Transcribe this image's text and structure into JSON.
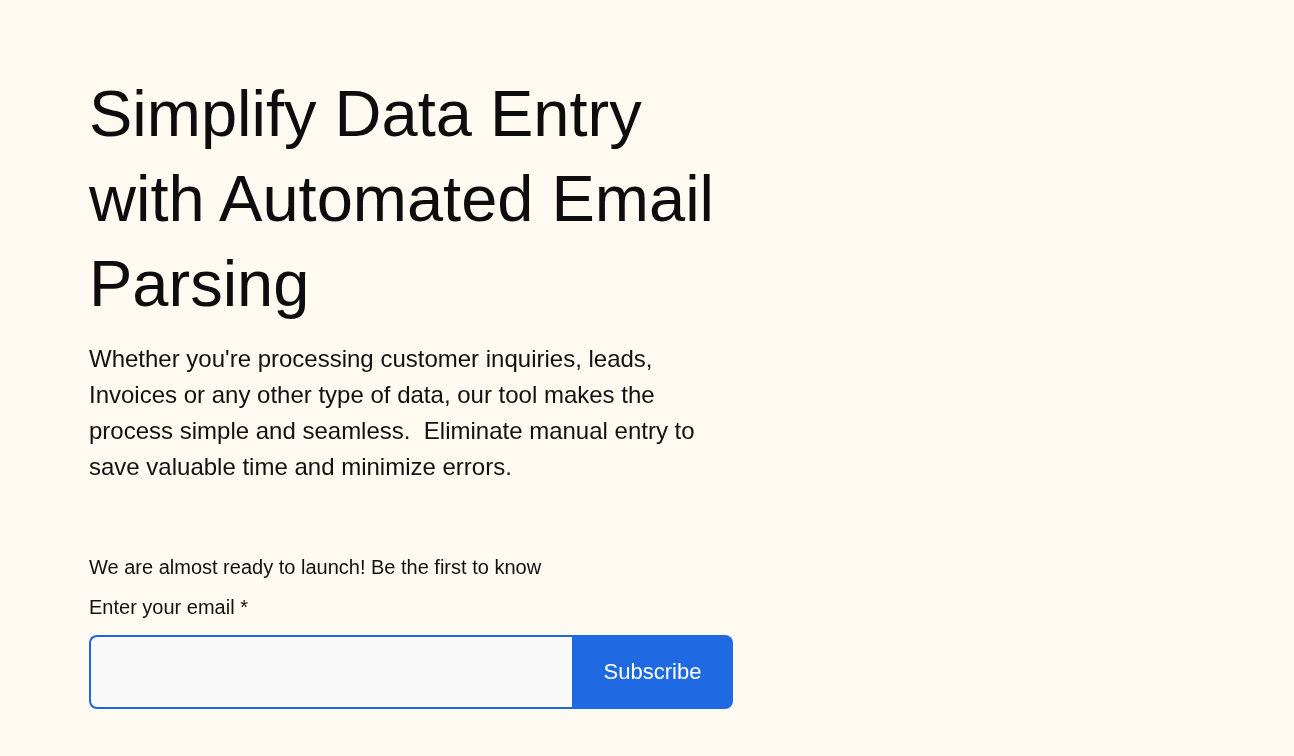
{
  "hero": {
    "title": "Simplify Data Entry with Automated Email Parsing",
    "description": "Whether you're processing customer inquiries, leads, Invoices or any other type of data, our tool makes the process simple and seamless.  Eliminate manual entry to save valuable time and minimize errors."
  },
  "signup": {
    "announcement": "We are almost ready to launch! Be the first to know",
    "email_label": "Enter your email *",
    "button": "Subscribe"
  }
}
